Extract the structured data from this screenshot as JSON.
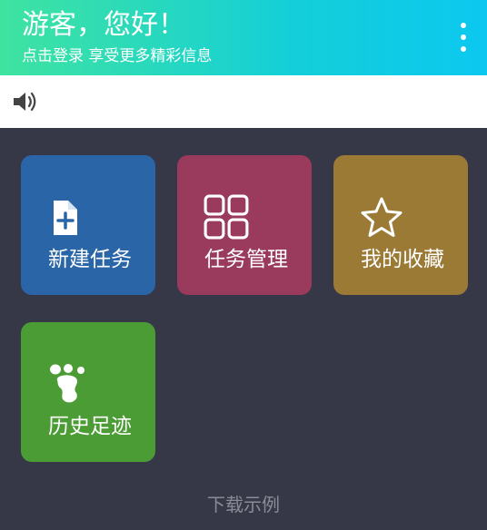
{
  "header": {
    "greeting": "游客，您好！",
    "subtitle": "点击登录 享受更多精彩信息",
    "menu_icon": "more-vertical-icon"
  },
  "notice": {
    "icon": "speaker-icon",
    "text": ""
  },
  "tiles": [
    {
      "label": "新建任务",
      "icon": "new-document-icon",
      "color": "#2a65a8"
    },
    {
      "label": "任务管理",
      "icon": "grid-icon",
      "color": "#9a3b5e"
    },
    {
      "label": "我的收藏",
      "icon": "star-icon",
      "color": "#9b7a36"
    },
    {
      "label": "历史足迹",
      "icon": "footprint-icon",
      "color": "#4b9c35"
    }
  ],
  "footer": {
    "download_label": "下载示例"
  },
  "colors": {
    "header_gradient_start": "#3fe3a0",
    "header_gradient_end": "#0cc8f0",
    "background": "#373847"
  }
}
